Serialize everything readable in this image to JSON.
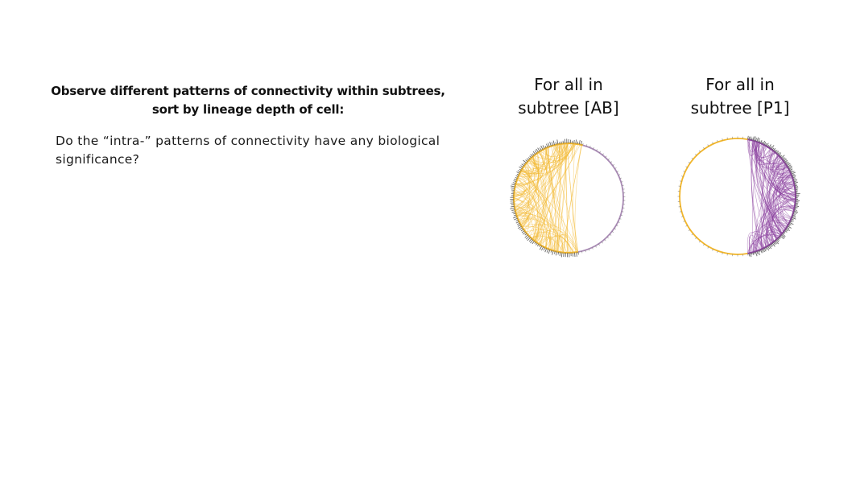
{
  "heading": {
    "line1": "Observe different patterns of connectivity within subtrees,",
    "line2": "sort by lineage depth of cell:"
  },
  "question": "Do the “intra-” patterns of connectivity have any biological significance?",
  "panels": [
    {
      "title_line1": "For all in",
      "title_line2": "subtree [AB]"
    },
    {
      "title_line1": "For all in",
      "title_line2": "subtree [P1]"
    }
  ],
  "colors": {
    "ab": "#f2b62a",
    "p1": "#8a3f9e",
    "node_ring": "#6b6b6b",
    "light_arc": "#a98ab5"
  }
}
